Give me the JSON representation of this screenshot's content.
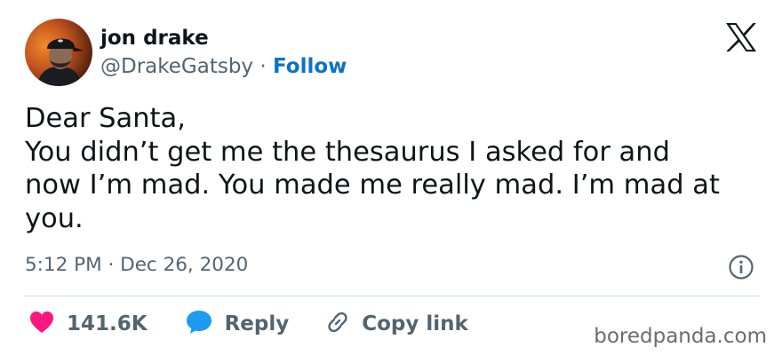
{
  "author": {
    "display_name": "jon drake",
    "handle": "@DrakeGatsby",
    "separator": "·",
    "follow_label": "Follow"
  },
  "tweet": {
    "lines": [
      "Dear Santa,",
      "You didn’t get me the thesaurus I asked for and",
      "now I’m mad. You made me really mad. I’m mad at",
      "you."
    ],
    "timestamp": "5:12 PM · Dec 26, 2020"
  },
  "actions": {
    "likes_count": "141.6K",
    "reply_label": "Reply",
    "copy_link_label": "Copy link"
  },
  "watermark": "boredpanda.com",
  "icons": {
    "brand": "x-logo-icon",
    "info": "info-icon",
    "like": "heart-icon",
    "reply": "speech-bubble-icon",
    "copy": "link-icon"
  },
  "colors": {
    "follow": "#0a73c9",
    "heart": "#f91880",
    "reply_bubble": "#1d9bf0",
    "secondary_text": "#536471",
    "primary_text": "#0f1419",
    "divider": "#cfd9de"
  }
}
